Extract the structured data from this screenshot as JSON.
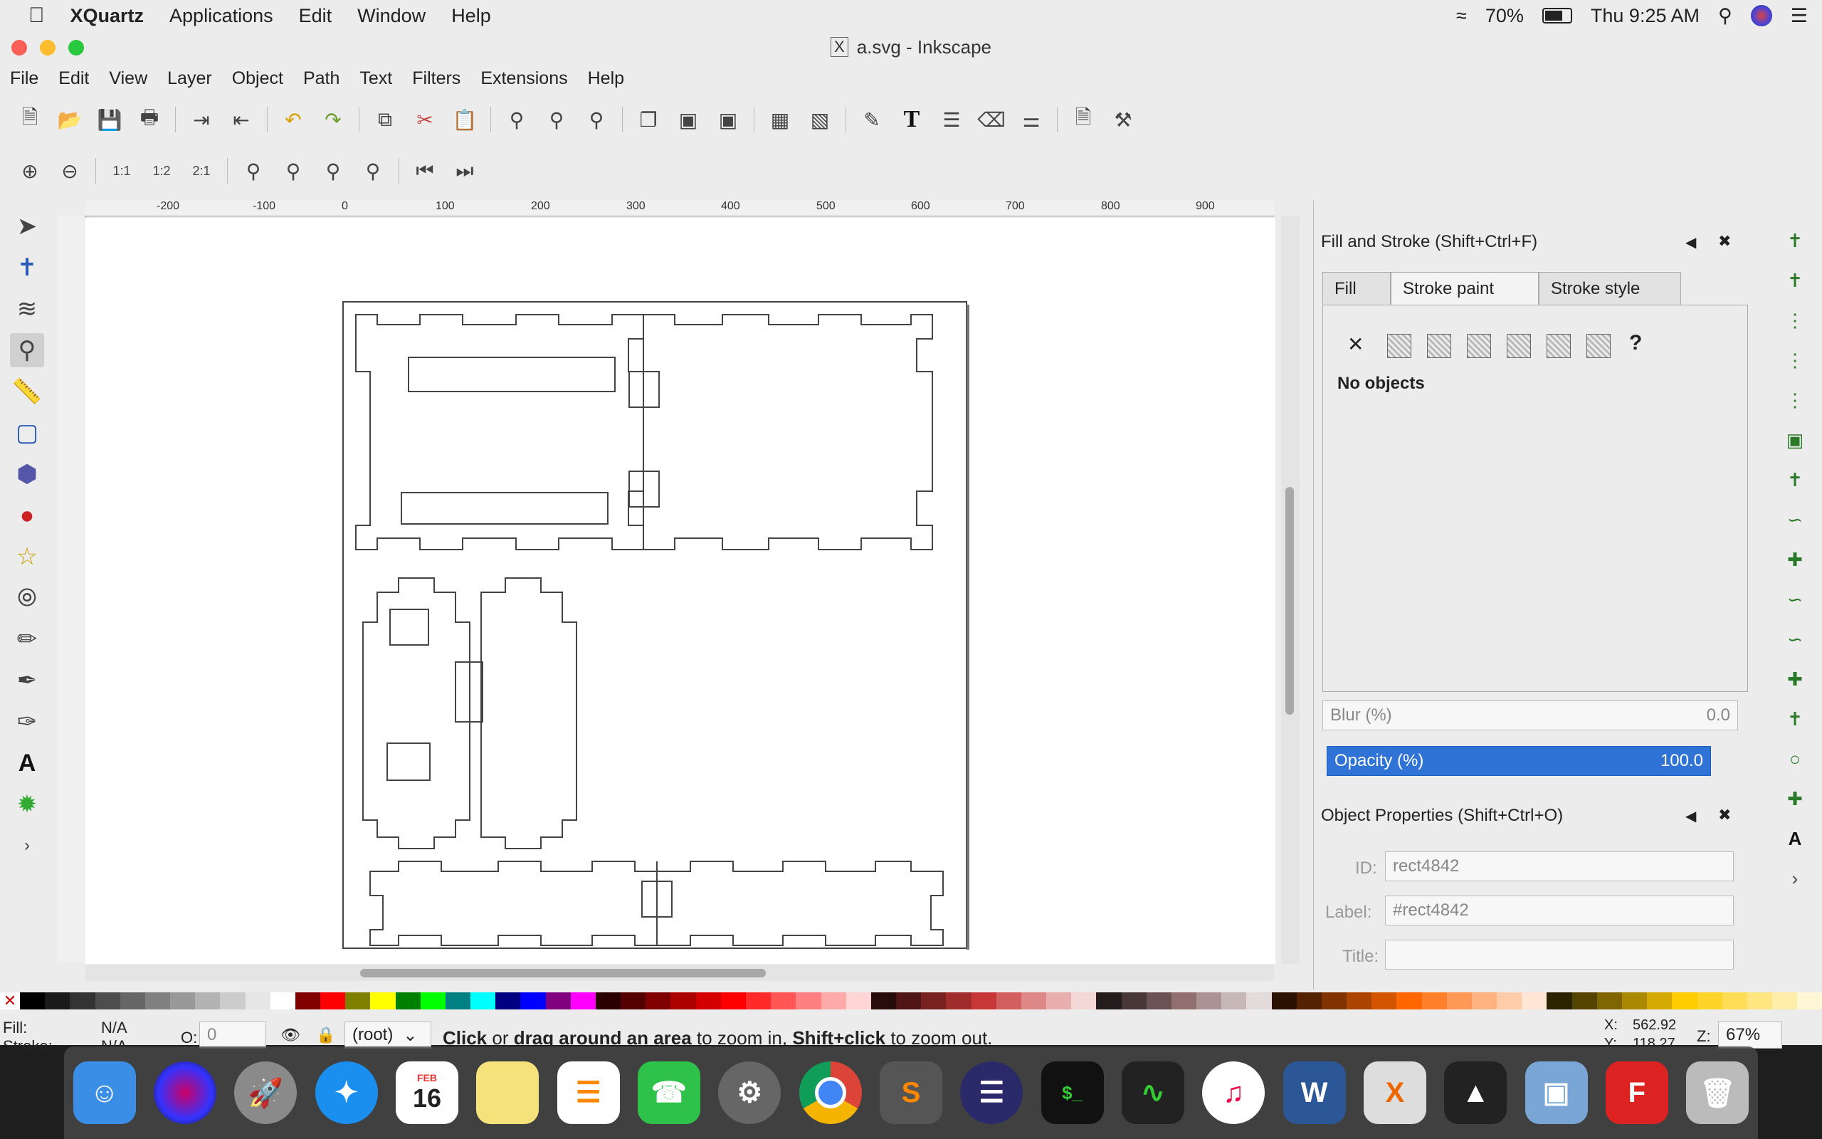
{
  "menubar": {
    "app_name": "XQuartz",
    "items": [
      "Applications",
      "Edit",
      "Window",
      "Help"
    ],
    "battery": "70%",
    "clock": "Thu 9:25 AM"
  },
  "window": {
    "title": "a.svg - Inkscape",
    "menu": [
      "File",
      "Edit",
      "View",
      "Layer",
      "Object",
      "Path",
      "Text",
      "Filters",
      "Extensions",
      "Help"
    ]
  },
  "ruler": {
    "labels": [
      "-200",
      "-100",
      "0",
      "100",
      "200",
      "300",
      "400",
      "500",
      "600",
      "700",
      "800",
      "900"
    ]
  },
  "panel": {
    "fill_stroke_title": "Fill and Stroke (Shift+Ctrl+F)",
    "tabs": [
      "Fill",
      "Stroke paint",
      "Stroke style"
    ],
    "no_objects": "No objects",
    "unknown_symbol": "?",
    "x_symbol": "✕",
    "blur_label": "Blur (%)",
    "blur_value": "0.0",
    "opacity_label": "Opacity (%)",
    "opacity_value": "100.0",
    "obj_props_title": "Object Properties (Shift+Ctrl+O)",
    "id_label": "ID:",
    "id_value": "rect4842",
    "label_label": "Label:",
    "label_value": "#rect4842",
    "title_label": "Title:",
    "title_value": ""
  },
  "status": {
    "fill_label": "Fill:",
    "fill_value": "N/A",
    "stroke_label": "Stroke:",
    "stroke_value": "N/A",
    "opacity_label": "O:",
    "opacity_value": "0",
    "layer": "(root)",
    "message_parts": [
      "Click",
      " or ",
      "drag around an area",
      " to zoom in, ",
      "Shift+click",
      " to zoom out."
    ],
    "x_label": "X:",
    "x_value": "562.92",
    "y_label": "Y:",
    "y_value": "118.27",
    "zoom_label": "Z:",
    "zoom_value": "67%"
  },
  "dock": {
    "calendar_month": "FEB",
    "calendar_day": "16"
  },
  "colors": {
    "selection_blue": "#2f73d6",
    "palette": [
      "#000000",
      "#1a1a1a",
      "#333333",
      "#4d4d4d",
      "#666666",
      "#808080",
      "#999999",
      "#b3b3b3",
      "#cccccc",
      "#e6e6e6",
      "#ffffff",
      "#800000",
      "#ff0000",
      "#808000",
      "#ffff00",
      "#008000",
      "#00ff00",
      "#008080",
      "#00ffff",
      "#000080",
      "#0000ff",
      "#800080",
      "#ff00ff",
      "#2b0000",
      "#550000",
      "#800000",
      "#aa0000",
      "#d40000",
      "#ff0000",
      "#ff2a2a",
      "#ff5555",
      "#ff8080",
      "#ffaaaa",
      "#ffd5d5",
      "#280b0b",
      "#501616",
      "#782121",
      "#a02c2c",
      "#c83737",
      "#d35f5f",
      "#de8787",
      "#e9afaf",
      "#f4d7d7",
      "#241c1c",
      "#483737",
      "#6c5353",
      "#916f6f",
      "#ac9393",
      "#c8b7b7",
      "#e3dbdb",
      "#2b1100",
      "#552200",
      "#803300",
      "#aa4400",
      "#d45500",
      "#ff6600",
      "#ff7f2a",
      "#ff9955",
      "#ffb380",
      "#ffccaa",
      "#ffe6d5",
      "#2b2200",
      "#554400",
      "#806600",
      "#aa8800",
      "#d4aa00",
      "#ffcc00",
      "#ffd42a",
      "#ffdd55",
      "#ffe680",
      "#ffeeaa",
      "#fff6d5"
    ]
  }
}
